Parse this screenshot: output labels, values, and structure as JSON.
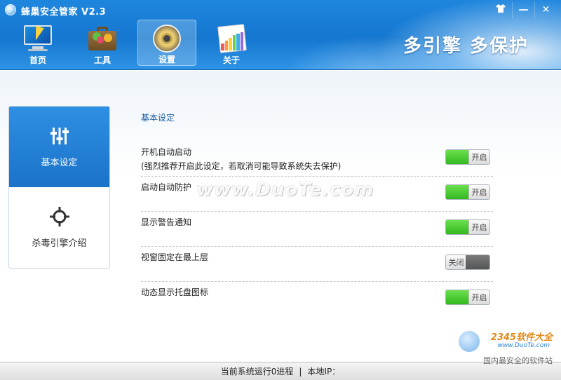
{
  "window": {
    "title": "蜂巢安全管家 V2.3",
    "controls": {
      "skin": "⌂",
      "minimize": "—",
      "close": "✕"
    }
  },
  "nav": {
    "items": [
      {
        "label": "首页",
        "icon": "monitor-icon"
      },
      {
        "label": "工具",
        "icon": "toolbox-icon"
      },
      {
        "label": "设置",
        "icon": "settings-icon"
      },
      {
        "label": "关于",
        "icon": "about-icon"
      }
    ],
    "active": "设置"
  },
  "slogan": "多引擎  多保护",
  "sidebar": {
    "items": [
      {
        "label": "基本设定",
        "icon": "sliders-icon"
      },
      {
        "label": "杀毒引擎介绍",
        "icon": "crosshair-icon"
      }
    ],
    "active": "基本设定"
  },
  "section_title": "基本设定",
  "settings": [
    {
      "label": "开机自动启动",
      "note": "(强烈推荐开启此设定，若取消可能导致系统失去保护)",
      "state": "开启"
    },
    {
      "label": "启动自动防护",
      "note": "",
      "state": "开启"
    },
    {
      "label": "显示警告通知",
      "note": "",
      "state": "开启"
    },
    {
      "label": "视窗固定在最上层",
      "note": "",
      "state": "关闭"
    },
    {
      "label": "动态显示托盘图标",
      "note": "",
      "state": "开启"
    }
  ],
  "watermark": "www.DuoTe.com",
  "status": {
    "process": "当前系统运行0进程",
    "divider": "|",
    "ip": "本地IP："
  },
  "brand": {
    "name": "2345软件大全",
    "url": "www.DuoTe.com",
    "tagline": "国内最安全的软件站"
  },
  "colors": {
    "header": "#1577cf",
    "toggle_on": "#33b81f",
    "toggle_off": "#555555",
    "section_title": "#1a5fa0"
  }
}
